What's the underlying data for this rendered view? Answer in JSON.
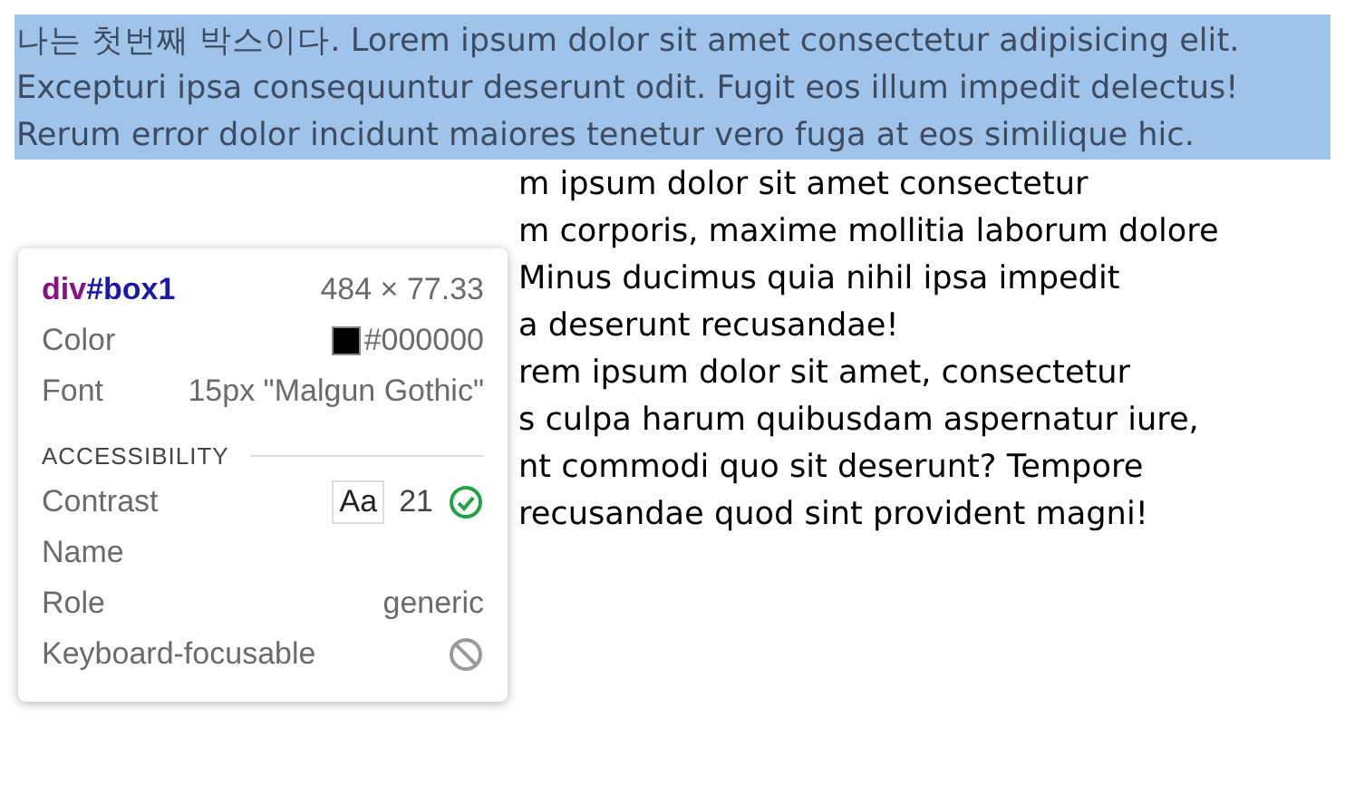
{
  "box1": {
    "text": "나는 첫번째 박스이다. Lorem ipsum dolor sit amet consectetur adipisicing elit. Excepturi ipsa consequuntur deserunt odit. Fugit eos illum impedit delectus! Rerum error dolor incidunt maiores tenetur vero fuga at eos similique hic."
  },
  "box2": {
    "lines": [
      "m ipsum dolor sit amet consectetur",
      "m corporis, maxime mollitia laborum dolore",
      "Minus ducimus quia nihil ipsa impedit",
      "a deserunt recusandae!",
      "rem ipsum dolor sit amet, consectetur",
      "s culpa harum quibusdam aspernatur iure,",
      "nt commodi quo sit deserunt? Tempore",
      "recusandae quod sint provident magni!"
    ]
  },
  "inspector": {
    "tag": "div",
    "id": "#box1",
    "size": "484 × 77.33",
    "properties": [
      {
        "kind": "color",
        "label": "Color",
        "color": "#000000",
        "value": "#000000"
      },
      {
        "kind": "text",
        "label": "Font",
        "value": "15px \"Malgun Gothic\""
      }
    ],
    "section": "ACCESSIBILITY",
    "accessibility": [
      {
        "kind": "contrast",
        "label": "Contrast",
        "sample": "Aa",
        "value": "21",
        "passes": true
      },
      {
        "kind": "text",
        "label": "Name"
      },
      {
        "kind": "text",
        "label": "Role",
        "value": "generic"
      },
      {
        "kind": "focusable",
        "label": "Keyboard-focusable",
        "focusable": false
      }
    ]
  }
}
